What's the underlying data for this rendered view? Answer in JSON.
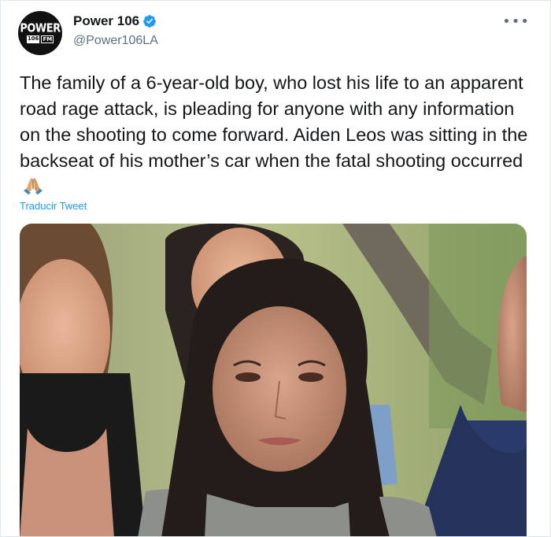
{
  "account": {
    "display_name": "Power 106",
    "handle": "@Power106LA",
    "avatar_line1": "POWER",
    "avatar_num": "106",
    "avatar_fm": "FM"
  },
  "tweet": {
    "text": "The family of a 6-year-old boy, who lost his life to an apparent road rage attack, is pleading for anyone with any information on the shooting to come forward. Aiden Leos was sitting in the backseat of his mother’s car when the fatal shooting occurred",
    "emoji": "folded-hands-emoji",
    "translate_label": "Traducir Tweet"
  },
  "icons": {
    "more": "more-icon",
    "verified": "verified-badge-icon"
  },
  "colors": {
    "link": "#1d9bf0",
    "text": "#14171a",
    "muted": "#5b7083",
    "verified": "#1d9bf0"
  }
}
